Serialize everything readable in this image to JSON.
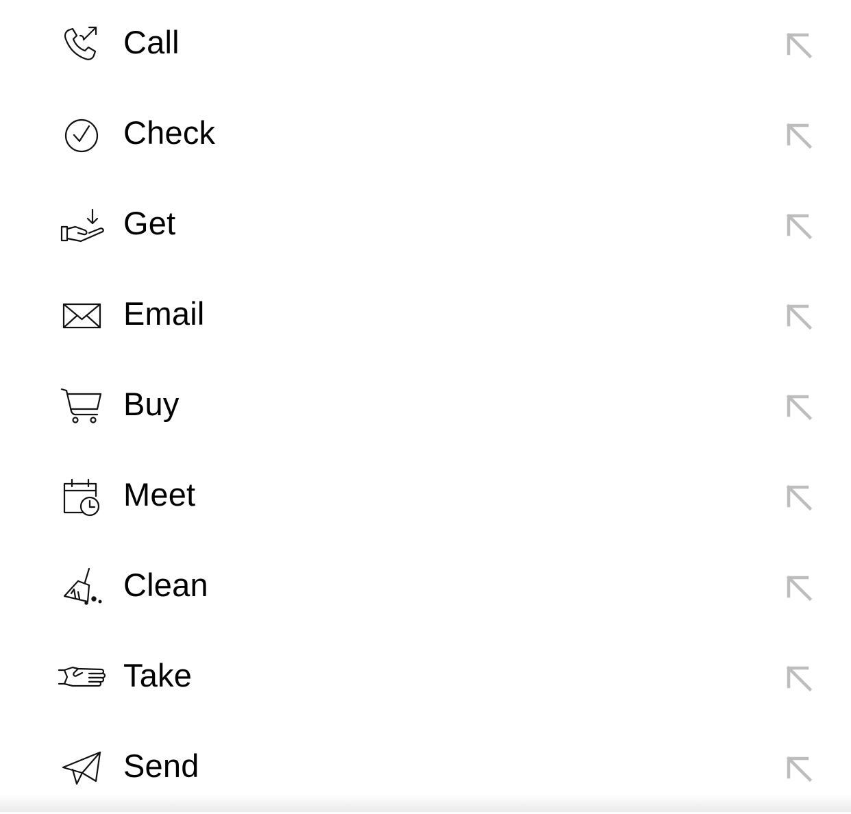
{
  "actions": [
    {
      "id": "call",
      "label": "Call",
      "icon": "phone-outgoing-icon"
    },
    {
      "id": "check",
      "label": "Check",
      "icon": "check-circle-icon"
    },
    {
      "id": "get",
      "label": "Get",
      "icon": "hand-receive-icon"
    },
    {
      "id": "email",
      "label": "Email",
      "icon": "envelope-icon"
    },
    {
      "id": "buy",
      "label": "Buy",
      "icon": "shopping-cart-icon"
    },
    {
      "id": "meet",
      "label": "Meet",
      "icon": "calendar-clock-icon"
    },
    {
      "id": "clean",
      "label": "Clean",
      "icon": "broom-icon"
    },
    {
      "id": "take",
      "label": "Take",
      "icon": "hand-pointing-icon"
    },
    {
      "id": "send",
      "label": "Send",
      "icon": "paper-plane-icon"
    }
  ],
  "row_action_icon": "arrow-up-left-icon",
  "colors": {
    "text": "#000000",
    "icon_stroke": "#111111",
    "arrow": "#bdbdbd",
    "background": "#ffffff"
  }
}
